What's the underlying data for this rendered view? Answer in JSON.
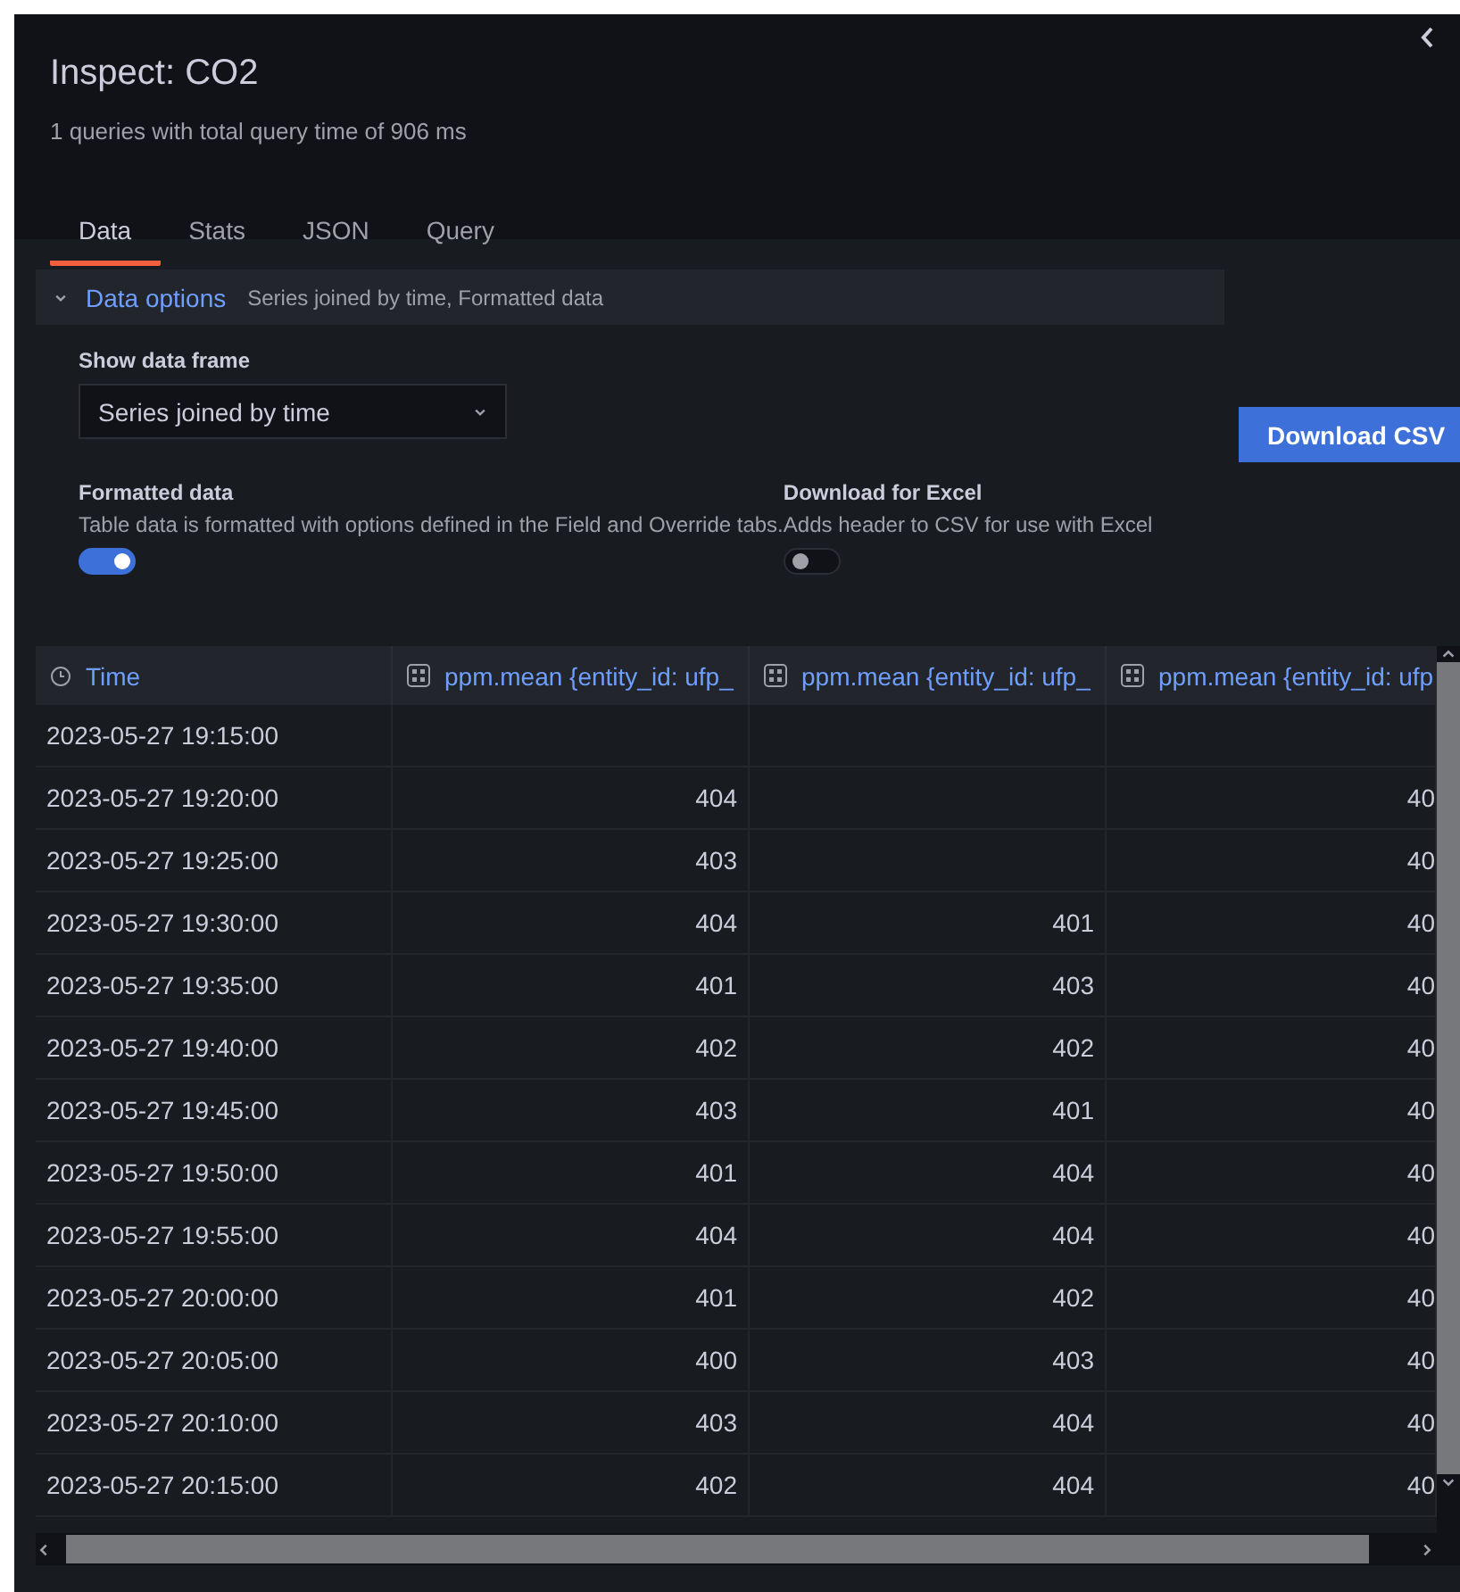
{
  "drawer": {
    "title": "Inspect: CO2",
    "subtitle": "1 queries with total query time of 906 ms"
  },
  "tabs": [
    {
      "label": "Data",
      "selected": true
    },
    {
      "label": "Stats",
      "selected": false
    },
    {
      "label": "JSON",
      "selected": false
    },
    {
      "label": "Query",
      "selected": false
    }
  ],
  "data_options": {
    "label": "Data options",
    "summary": "Series joined by time, Formatted data",
    "expanded": true
  },
  "show_data_frame": {
    "label": "Show data frame",
    "value": "Series joined by time"
  },
  "download_button": "Download CSV",
  "switches": [
    {
      "label": "Formatted data",
      "description": "Table data is formatted with options defined in the Field and Override tabs.",
      "on": true
    },
    {
      "label": "Download for Excel",
      "description": "Adds header to CSV for use with Excel",
      "on": false
    }
  ],
  "table": {
    "columns": [
      {
        "label": "Time",
        "kind": "time"
      },
      {
        "label": "ppm.mean {entity_id: ufp_",
        "kind": "number"
      },
      {
        "label": "ppm.mean {entity_id: ufp_",
        "kind": "number"
      },
      {
        "label": "ppm.mean {entity_id: ufp",
        "kind": "number"
      }
    ],
    "rows": [
      [
        "2023-05-27 19:15:00",
        "",
        "",
        ""
      ],
      [
        "2023-05-27 19:20:00",
        "404",
        "",
        "40"
      ],
      [
        "2023-05-27 19:25:00",
        "403",
        "",
        "40"
      ],
      [
        "2023-05-27 19:30:00",
        "404",
        "401",
        "40"
      ],
      [
        "2023-05-27 19:35:00",
        "401",
        "403",
        "40"
      ],
      [
        "2023-05-27 19:40:00",
        "402",
        "402",
        "40"
      ],
      [
        "2023-05-27 19:45:00",
        "403",
        "401",
        "40"
      ],
      [
        "2023-05-27 19:50:00",
        "401",
        "404",
        "40"
      ],
      [
        "2023-05-27 19:55:00",
        "404",
        "404",
        "40"
      ],
      [
        "2023-05-27 20:00:00",
        "401",
        "402",
        "40"
      ],
      [
        "2023-05-27 20:05:00",
        "400",
        "403",
        "40"
      ],
      [
        "2023-05-27 20:10:00",
        "403",
        "404",
        "40"
      ],
      [
        "2023-05-27 20:15:00",
        "402",
        "404",
        "40"
      ]
    ]
  }
}
